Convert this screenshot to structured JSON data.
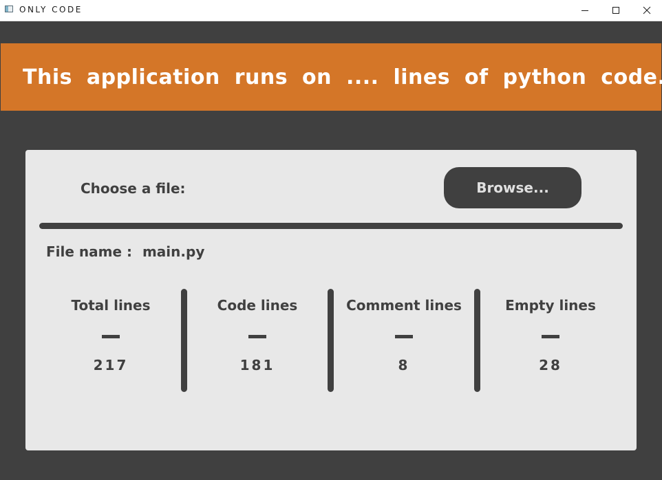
{
  "window": {
    "title": "ONLY CODE",
    "icons": [
      "minimize-icon",
      "maximize-icon",
      "close-icon"
    ]
  },
  "banner": {
    "text": "This application runs on .... lines of python code."
  },
  "file_chooser": {
    "label": "Choose a file:",
    "browse_label": "Browse..."
  },
  "file_info": {
    "label": "File name :",
    "value": "main.py"
  },
  "stats": [
    {
      "title": "Total lines",
      "value": "217"
    },
    {
      "title": "Code lines",
      "value": "181"
    },
    {
      "title": "Comment lines",
      "value": "8"
    },
    {
      "title": "Empty lines",
      "value": "28"
    }
  ],
  "colors": {
    "background": "#404040",
    "banner": "#d47628",
    "panel": "#e8e8e8",
    "text_dark": "#404040",
    "text_light": "#ffffff"
  }
}
